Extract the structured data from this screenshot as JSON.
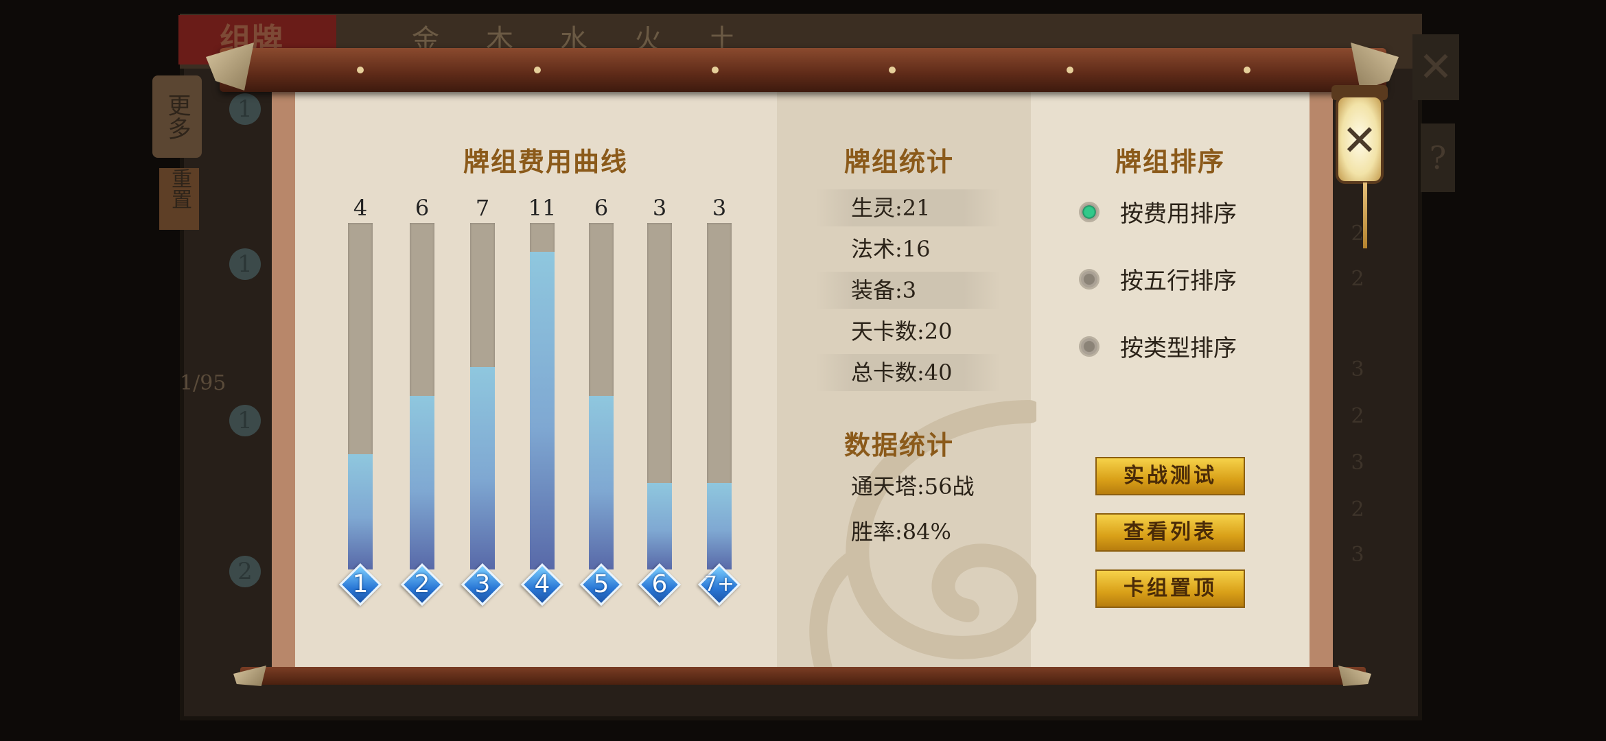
{
  "background": {
    "title": "组牌",
    "elements": [
      "金",
      "木",
      "水",
      "火",
      "土"
    ],
    "side_more": "更多",
    "side_reset": "重置",
    "page_indicator": "1/95",
    "close_label": "✕",
    "help_label": "?"
  },
  "cost_curve": {
    "title": "牌组费用曲线",
    "costs": [
      "1",
      "2",
      "3",
      "4",
      "5",
      "6",
      "7+"
    ],
    "counts": [
      4,
      6,
      7,
      11,
      6,
      3,
      3
    ],
    "max_count": 12
  },
  "deck_stats": {
    "title": "牌组统计",
    "rows": [
      "生灵:21",
      "法术:16",
      "装备:3",
      "天卡数:20",
      "总卡数:40"
    ]
  },
  "data_stats": {
    "title": "数据统计",
    "rows": [
      "通天塔:56战",
      "胜率:84%"
    ]
  },
  "deck_sort": {
    "title": "牌组排序",
    "options": [
      {
        "label": "按费用排序",
        "selected": true
      },
      {
        "label": "按五行排序",
        "selected": false
      },
      {
        "label": "按类型排序",
        "selected": false
      }
    ]
  },
  "actions": {
    "test": "实战测试",
    "view_list": "查看列表",
    "pin_deck": "卡组置顶"
  },
  "close": {
    "label": "✕"
  },
  "colors": {
    "accent_gold": "#d9a018",
    "radio_on": "#32c98a",
    "bar_blue": "#7fa8d2",
    "title_brown": "#8b5a1a"
  },
  "icons": {
    "close": "close-icon",
    "cost_gem": "diamond-gem-icon",
    "lantern": "lantern-icon"
  }
}
